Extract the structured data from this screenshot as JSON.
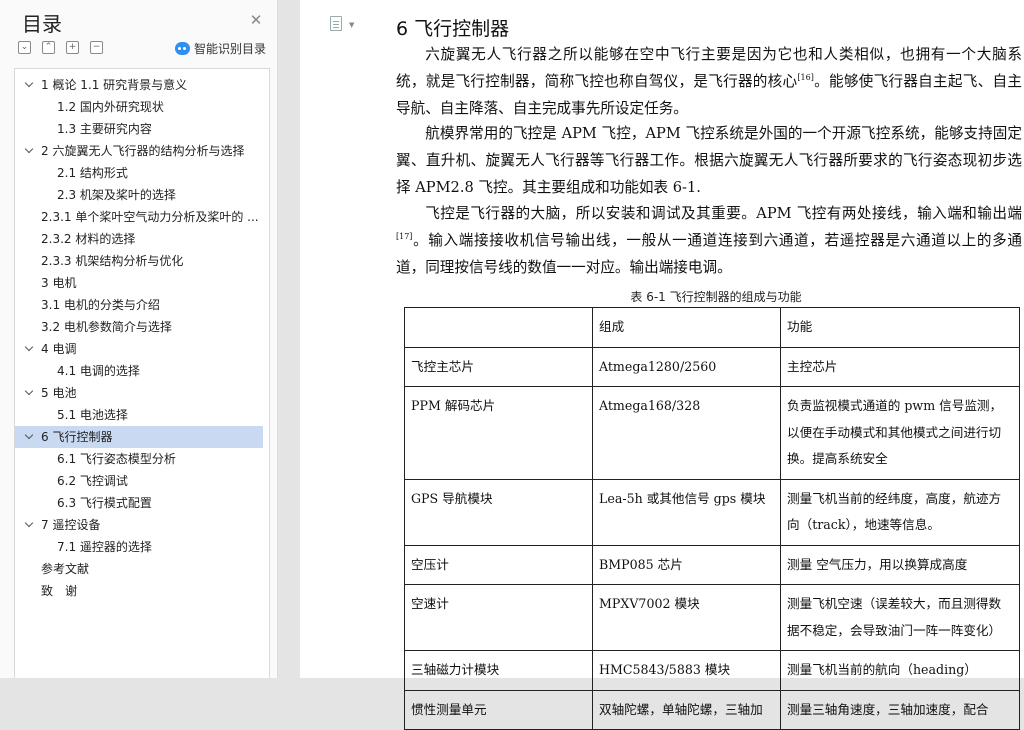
{
  "sidebar": {
    "title": "目录",
    "smart_toc": "智能识别目录",
    "items": [
      {
        "label": "1 概论 1.1 研究背景与意义"
      },
      {
        "label": "1.2 国内外研究现状"
      },
      {
        "label": "1.3 主要研究内容"
      },
      {
        "label": "2 六旋翼无人飞行器的结构分析与选择"
      },
      {
        "label": "2.1 结构形式"
      },
      {
        "label": "2.3 机架及桨叶的选择"
      },
      {
        "label": "2.3.1 单个桨叶空气动力分析及桨叶的 ..."
      },
      {
        "label": "2.3.2 材料的选择"
      },
      {
        "label": "2.3.3 机架结构分析与优化"
      },
      {
        "label": "3 电机"
      },
      {
        "label": "3.1 电机的分类与介绍"
      },
      {
        "label": "3.2 电机参数简介与选择"
      },
      {
        "label": "4 电调"
      },
      {
        "label": "4.1 电调的选择"
      },
      {
        "label": "5 电池"
      },
      {
        "label": "5.1 电池选择"
      },
      {
        "label": "6 飞行控制器"
      },
      {
        "label": "6.1 飞行姿态模型分析"
      },
      {
        "label": "6.2 飞控调试"
      },
      {
        "label": "6.3 飞行模式配置"
      },
      {
        "label": "7 遥控设备"
      },
      {
        "label": "7.1 遥控器的选择"
      },
      {
        "label": "参考文献"
      },
      {
        "label": "致　谢"
      }
    ]
  },
  "doc": {
    "heading": "6 飞行控制器",
    "p1a": "六旋翼无人飞行器之所以能够在空中飞行主要是因为它也和人类相似，也拥有一个大脑系统，就是飞行控制器，简称飞控也称自驾仪，是飞行器的核心",
    "p1_ref": "[16]",
    "p1b": "。能够使飞行器自主起飞、自主导航、自主降落、自主完成事先所设定任务。",
    "p2": "航模界常用的飞控是 APM 飞控，APM 飞控系统是外国的一个开源飞控系统，能够支持固定翼、直升机、旋翼无人飞行器等飞行器工作。根据六旋翼无人飞行器所要求的飞行姿态现初步选择 APM2.8 飞控。其主要组成和功能如表 6-1.",
    "p3a": "飞控是飞行器的大脑，所以安装和调试及其重要。APM 飞控有两处接线，输入端和输出端",
    "p3_ref": "[17]",
    "p3b": "。输入端接接收机信号输出线，一般从一通道连接到六通道，若遥控器是六通道以上的多通道，同理按信号线的数值一一对应。输出端接电调。",
    "table_caption": "表 6-1 飞行控制器的组成与功能",
    "table": {
      "headers": [
        "",
        "组成",
        "功能"
      ],
      "rows": [
        [
          "飞控主芯片",
          "Atmega1280/2560",
          "主控芯片"
        ],
        [
          "PPM 解码芯片",
          "Atmega168/328",
          "负责监视模式通道的 pwm 信号监测，以便在手动模式和其他模式之间进行切换。提高系统安全"
        ],
        [
          "GPS 导航模块",
          "Lea-5h 或其他信号 gps 模块",
          "测量飞机当前的经纬度，高度，航迹方向（track），地速等信息。"
        ],
        [
          "空压计",
          "BMP085 芯片",
          "测量 空气压力，用以换算成高度"
        ],
        [
          "空速计",
          "MPXV7002 模块",
          "测量飞机空速（误差较大，而且测得数据不稳定，会导致油门一阵一阵变化）"
        ],
        [
          "三轴磁力计模块",
          "HMC5843/5883 模块",
          "测量飞机当前的航向（heading）"
        ],
        [
          "惯性测量单元",
          "双轴陀螺，单轴陀螺，三轴加",
          "测量三轴角速度，三轴加速度，配合"
        ]
      ]
    }
  }
}
